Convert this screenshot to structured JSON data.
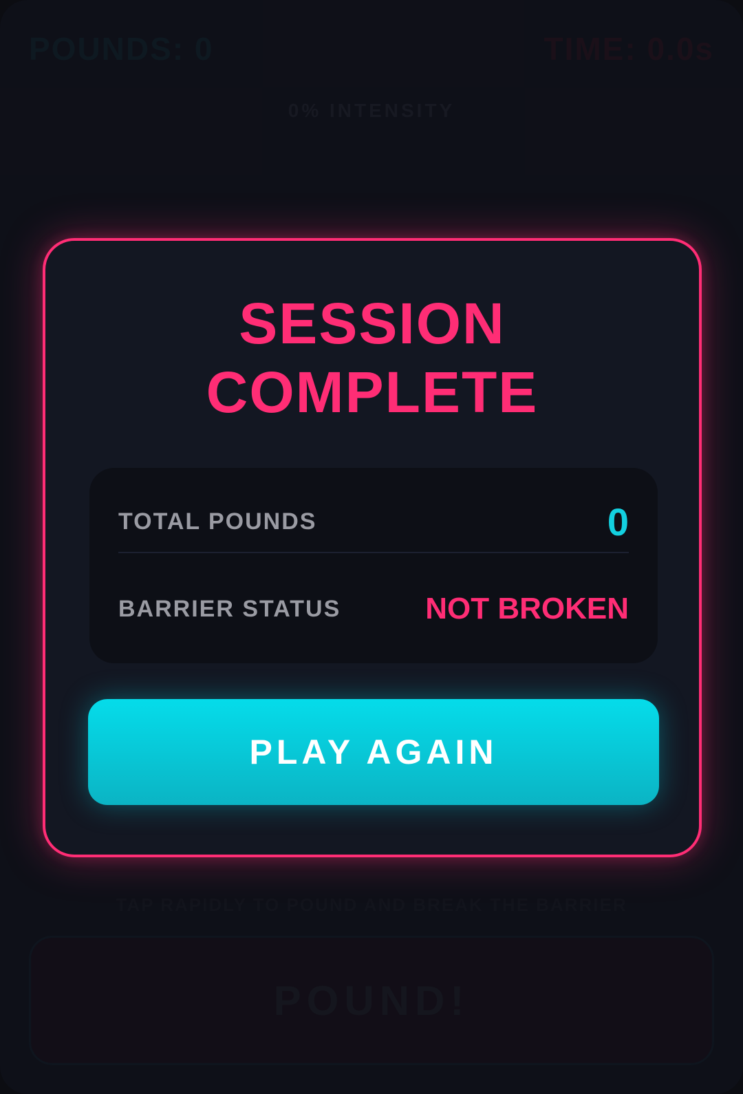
{
  "hud": {
    "pounds_label": "POUNDS: 0",
    "time_label": "TIME: 0.0s",
    "intensity_label": "0% INTENSITY"
  },
  "game": {
    "hint": "TAP RAPIDLY TO POUND AND BREAK THE BARRIER",
    "pound_button_label": "POUND!"
  },
  "modal": {
    "title_line1": "SESSION",
    "title_line2": "COMPLETE",
    "stats": [
      {
        "label": "TOTAL POUNDS",
        "value": "0"
      },
      {
        "label": "BARRIER STATUS",
        "value": "NOT BROKEN"
      }
    ],
    "play_again_label": "PLAY AGAIN"
  },
  "colors": {
    "accent_pink": "#ff2d75",
    "accent_cyan": "#13d0e0",
    "background": "#0f1119"
  }
}
